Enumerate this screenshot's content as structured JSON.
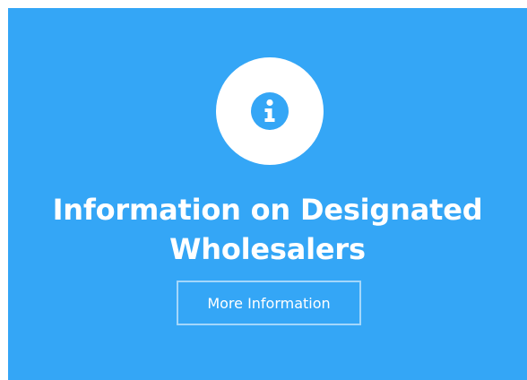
{
  "card": {
    "icon": "info-circle-icon",
    "title_line1": "Information on Designated",
    "title_line2": "Wholesalers",
    "button_label": "More Information"
  },
  "colors": {
    "card_background": "#34a6f6",
    "icon_circle": "#ffffff",
    "text": "#ffffff"
  }
}
